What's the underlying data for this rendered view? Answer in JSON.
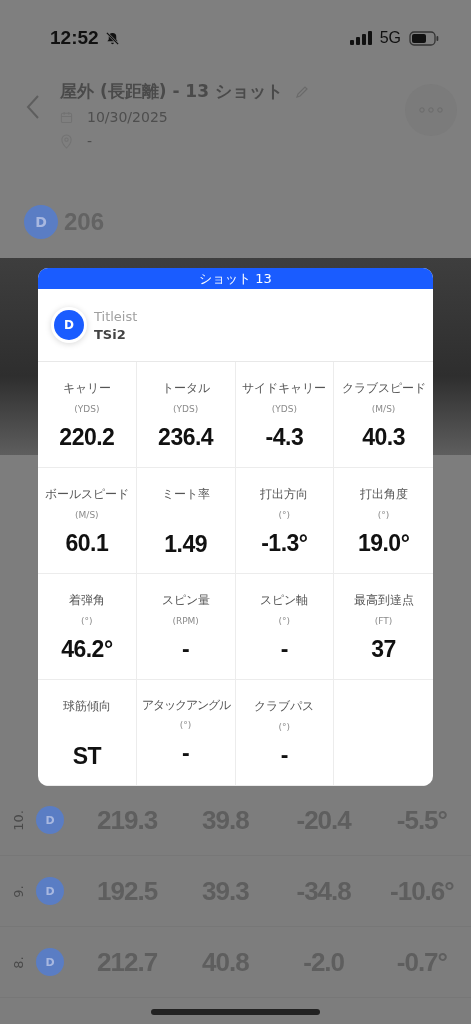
{
  "status_bar": {
    "time": "12:52",
    "network": "5G"
  },
  "header": {
    "title": "屋外 (長距離) - 13 ショット",
    "date": "10/30/2025",
    "location": "-"
  },
  "summary": {
    "club_badge": "D",
    "distance": "206"
  },
  "rows": [
    {
      "number": "10.",
      "club": "D",
      "values": [
        "219.3",
        "39.8",
        "-20.4",
        "-5.5°"
      ]
    },
    {
      "number": "9.",
      "club": "D",
      "values": [
        "192.5",
        "39.3",
        "-34.8",
        "-10.6°"
      ]
    },
    {
      "number": "8.",
      "club": "D",
      "values": [
        "212.7",
        "40.8",
        "-2.0",
        "-0.7°"
      ]
    }
  ],
  "modal": {
    "title": "ショット 13",
    "club_badge": "D",
    "brand": "Titleist",
    "model": "TSi2",
    "metrics": [
      {
        "label": "キャリー",
        "unit": "(YDS)",
        "value": "220.2"
      },
      {
        "label": "トータル",
        "unit": "(YDS)",
        "value": "236.4"
      },
      {
        "label": "サイドキャリー",
        "unit": "(YDS)",
        "value": "-4.3"
      },
      {
        "label": "クラブスピード",
        "unit": "(M/S)",
        "value": "40.3"
      },
      {
        "label": "ボールスピード",
        "unit": "(M/S)",
        "value": "60.1"
      },
      {
        "label": "ミート率",
        "value": "1.49"
      },
      {
        "label": "打出方向",
        "unit": "(°)",
        "value": "-1.3°"
      },
      {
        "label": "打出角度",
        "unit": "(°)",
        "value": "19.0°"
      },
      {
        "label": "着弾角",
        "unit": "(°)",
        "value": "46.2°"
      },
      {
        "label": "スピン量",
        "unit": "(RPM)",
        "value": "-"
      },
      {
        "label": "スピン軸",
        "unit": "(°)",
        "value": "-"
      },
      {
        "label": "最高到達点",
        "unit": "(FT)",
        "value": "37"
      },
      {
        "label": "球筋傾向",
        "value": "ST"
      },
      {
        "label": "アタックアングル",
        "unit": "(°)",
        "value": "-",
        "small": true
      },
      {
        "label": "クラブパス",
        "unit": "(°)",
        "value": "-"
      }
    ]
  }
}
